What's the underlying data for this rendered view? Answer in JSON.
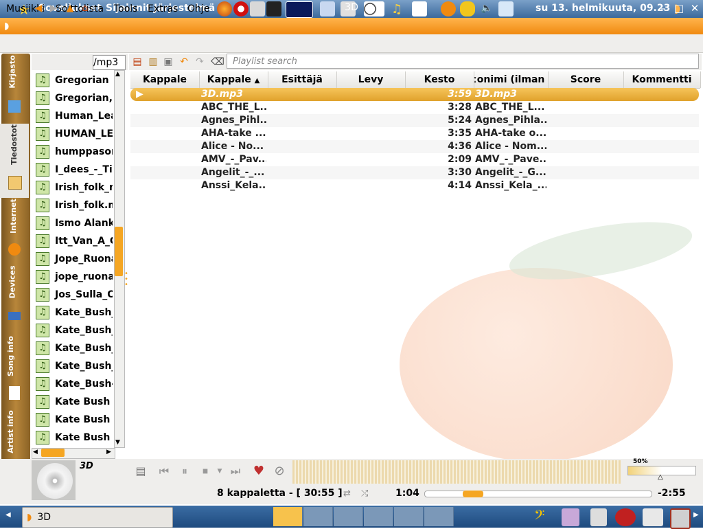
{
  "top_panel": {
    "menus": [
      "Sovellukset",
      "Sijainnit",
      "Järjestelmä"
    ],
    "clock": "su 13. helmikuuta, 09.23"
  },
  "window": {
    "title": "3D"
  },
  "menubar": [
    "Musiikki",
    "Soittolista",
    "Tools",
    "Extras",
    "Ohje"
  ],
  "side_tabs": [
    "Kirjasto",
    "Tiedostot",
    "Internet",
    "Devices",
    "Song info",
    "Artist info"
  ],
  "browser": {
    "path": "/mp3",
    "files": [
      "Gregorian -",
      "Gregorian,",
      "Human_Lea",
      "HUMAN_LEA",
      "humppasor",
      "I_dees_-_Tin",
      "Irish_folk_m",
      "Irish_folk.m",
      "Ismo Alank",
      "Itt_Van_A_G",
      "Jope_Ruona",
      "jope_ruona",
      "Jos_Sulla_O",
      "Kate_Bush_",
      "Kate_Bush_",
      "Kate_Bush_",
      "Kate_Bush_",
      "Kate_Bush-",
      "Kate Bush -",
      "Kate Bush -",
      "Kate Bush -"
    ]
  },
  "playlist": {
    "search_placeholder": "Playlist search",
    "columns": [
      "Kappale",
      "Kappale",
      "Esittäjä",
      "Levy",
      "Kesto",
      "ːonimi (ilman p",
      "Score",
      "Kommentti"
    ],
    "rows": [
      {
        "title": "3D.mp3",
        "length": "3:59",
        "filename": "3D.mp3"
      },
      {
        "title": "ABC_THE_L...",
        "length": "3:28",
        "filename": "ABC_THE_L..."
      },
      {
        "title": "Agnes_Pihl...",
        "length": "5:24",
        "filename": "Agnes_Pihla..."
      },
      {
        "title": "AHA-take ...",
        "length": "3:35",
        "filename": "AHA-take o..."
      },
      {
        "title": "Alice - No...",
        "length": "4:36",
        "filename": "Alice - Nom..."
      },
      {
        "title": "AMV_-_Pav...",
        "length": "2:09",
        "filename": "AMV_-_Pave..."
      },
      {
        "title": "Angelit_-_...",
        "length": "3:30",
        "filename": "Angelit_-_G..."
      },
      {
        "title": "Anssi_Kela...",
        "length": "4:14",
        "filename": "Anssi_Kela_..."
      }
    ]
  },
  "now_playing": {
    "title": "3D",
    "status": "8 kappaletta - [ 30:55 ]",
    "elapsed": "1:04",
    "remaining": "-2:55",
    "progress_fraction": 0.26,
    "volume": "50%"
  },
  "taskbar": {
    "task": "3D"
  },
  "colors": {
    "accent": "#f5a623",
    "panel": "#3c6a9c"
  }
}
